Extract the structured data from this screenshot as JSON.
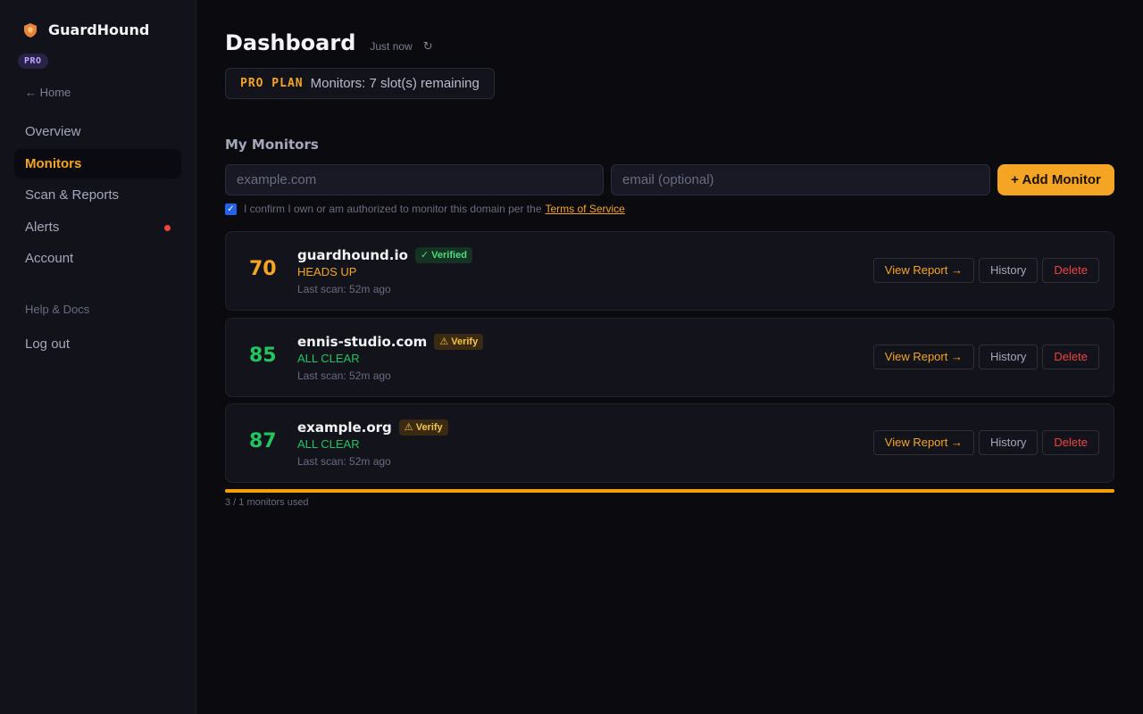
{
  "brand": {
    "name": "GuardHound",
    "plan_badge": "PRO"
  },
  "sidebar": {
    "home_link": "← Home",
    "items": [
      {
        "label": "Overview",
        "active": false
      },
      {
        "label": "Monitors",
        "active": true
      },
      {
        "label": "Scan & Reports",
        "active": false
      },
      {
        "label": "Alerts",
        "active": false,
        "notification_dot": true
      },
      {
        "label": "Account",
        "active": false
      }
    ],
    "help": "Help & Docs",
    "logout": "Log out"
  },
  "header": {
    "title": "Dashboard",
    "updated": "Just now",
    "refresh_icon": "↻"
  },
  "plan": {
    "label": "PRO PLAN",
    "text": "Monitors: 7 slot(s) remaining"
  },
  "monitors_section": {
    "title": "My Monitors",
    "domain_placeholder": "example.com",
    "email_placeholder": "email (optional)",
    "add_button": "+ Add Monitor",
    "confirm_text": "I confirm I own or am authorized to monitor this domain per the",
    "tos_link": "Terms of Service",
    "confirm_checked": true
  },
  "monitors": [
    {
      "score": "70",
      "score_color": "#f5a524",
      "domain": "guardhound.io",
      "badge": "✓ Verified",
      "badge_type": "verified",
      "status": "HEADS UP",
      "status_color": "#f5a524",
      "last_scan": "Last scan: 52m ago"
    },
    {
      "score": "85",
      "score_color": "#22c55e",
      "domain": "ennis-studio.com",
      "badge": "⚠ Verify",
      "badge_type": "verify",
      "status": "ALL CLEAR",
      "status_color": "#22c55e",
      "last_scan": "Last scan: 52m ago"
    },
    {
      "score": "87",
      "score_color": "#22c55e",
      "domain": "example.org",
      "badge": "⚠ Verify",
      "badge_type": "verify",
      "status": "ALL CLEAR",
      "status_color": "#22c55e",
      "last_scan": "Last scan: 52m ago"
    }
  ],
  "actions": {
    "view_report": "View Report →",
    "history": "History",
    "delete": "Delete"
  },
  "usage": {
    "text": "3 / 1 monitors used",
    "fill_fraction": 1.0
  },
  "colors": {
    "accent": "#f5a524",
    "success": "#22c55e",
    "danger": "#ef4444",
    "background": "#0a0a0f",
    "sidebar": "#11121a"
  }
}
